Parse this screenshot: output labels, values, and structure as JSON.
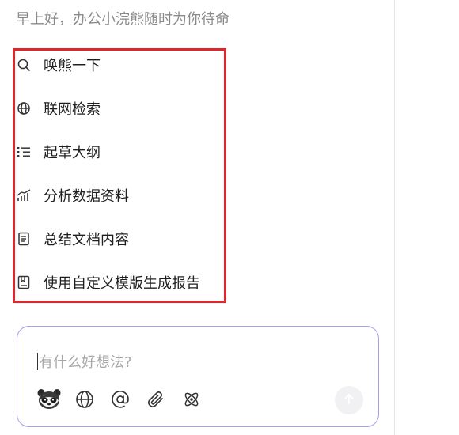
{
  "greeting": "早上好，办公小浣熊随时为你待命",
  "menu": [
    {
      "label": "唤熊一下",
      "icon": "search-icon"
    },
    {
      "label": "联网检索",
      "icon": "globe-icon"
    },
    {
      "label": "起草大纲",
      "icon": "outline-list-icon"
    },
    {
      "label": "分析数据资料",
      "icon": "bar-chart-icon"
    },
    {
      "label": "总结文档内容",
      "icon": "document-icon"
    },
    {
      "label": "使用自定义模版生成报告",
      "icon": "bookmark-template-icon"
    }
  ],
  "input": {
    "placeholder": "有什么好想法?"
  },
  "toolbar": {
    "tools": [
      "raccoon-avatar-icon",
      "globe-icon",
      "at-mention-icon",
      "paperclip-icon",
      "atom-icon"
    ],
    "send": "arrow-up-icon"
  },
  "colors": {
    "highlight": "#e0262b",
    "input_border": "#a99de8",
    "text": "#1f1f1f",
    "muted": "#8a8a8a"
  }
}
